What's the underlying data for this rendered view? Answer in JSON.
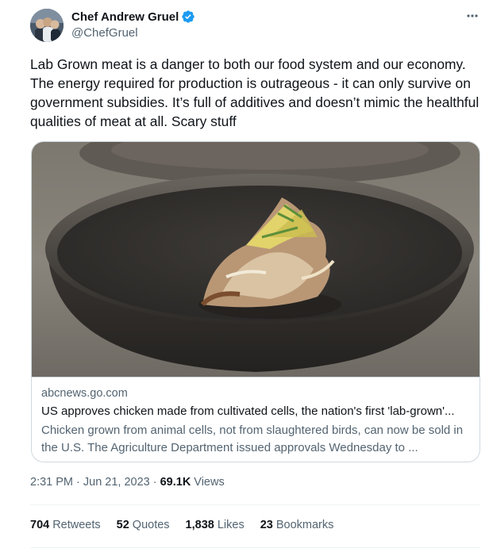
{
  "author": {
    "display_name": "Chef Andrew Gruel",
    "handle": "@ChefGruel",
    "verified_icon": "verified-badge-icon",
    "verified_color": "#1d9bf0"
  },
  "more_icon": "more-horizontal-icon",
  "tweet": {
    "text": "Lab Grown meat is a danger to both our food system and our economy. The energy required for production is outrageous - it can only survive on government subsidies. It’s full of additives and doesn’t mimic the healthful qualities of meat at all. Scary stuff"
  },
  "card": {
    "image_icon": "food-bowl-photo",
    "domain": "abcnews.go.com",
    "title": "US approves chicken made from cultivated cells, the nation's first 'lab-grown'...",
    "description": "Chicken grown from animal cells, not from slaughtered birds, can now be sold in the U.S. The Agriculture Department issued approvals Wednesday to ..."
  },
  "meta": {
    "timestamp": "2:31 PM · Jun 21, 2023 · ",
    "views_count": "69.1K",
    "views_label": "Views"
  },
  "stats": {
    "retweets_count": "704",
    "retweets_label": "Retweets",
    "quotes_count": "52",
    "quotes_label": "Quotes",
    "likes_count": "1,838",
    "likes_label": "Likes",
    "bookmarks_count": "23",
    "bookmarks_label": "Bookmarks"
  },
  "colors": {
    "text_primary": "#0f1419",
    "text_secondary": "#536471",
    "border": "#cfd9de",
    "accent": "#1d9bf0"
  }
}
